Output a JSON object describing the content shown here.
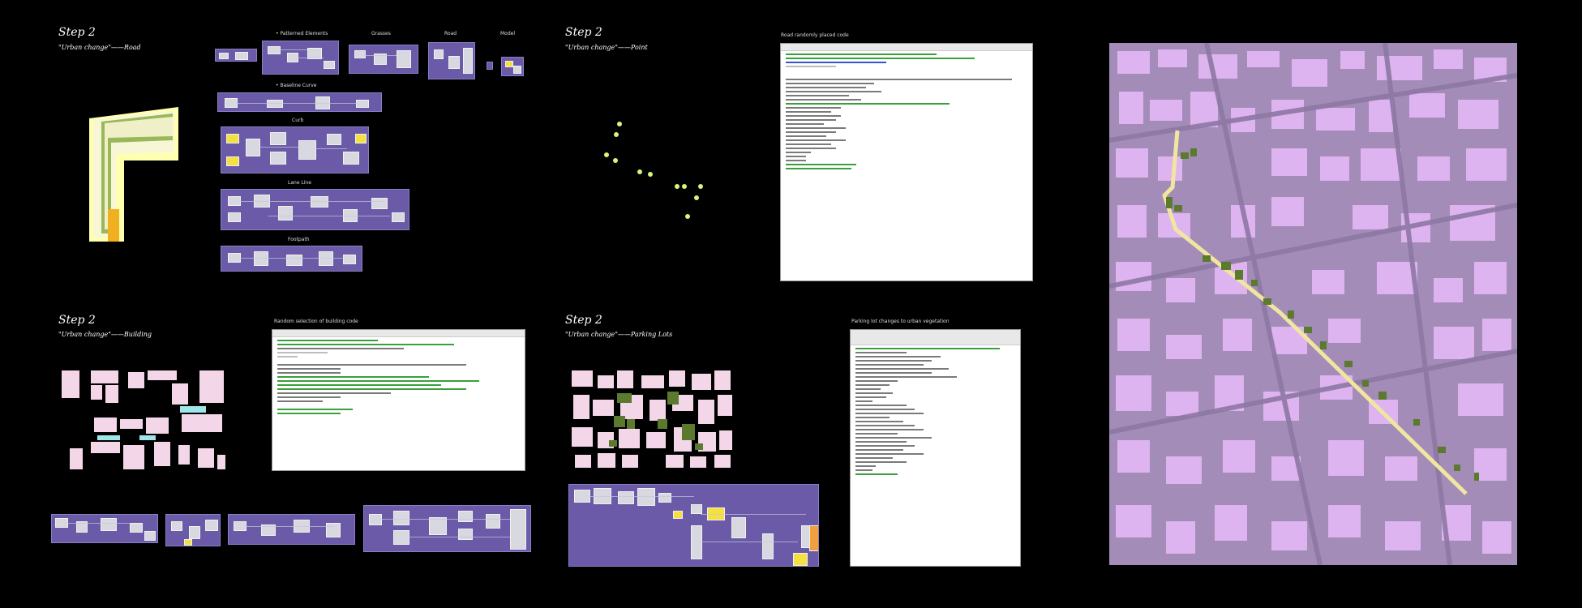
{
  "panels": {
    "road": {
      "step": "Step 2",
      "subtitle": "\"Urban change\"——Road",
      "captions": [
        "• Patterned Elements",
        "Grasses",
        "Road",
        "Model",
        "• Baseline Curve",
        "Curb",
        "Lane Line",
        "Footpath"
      ]
    },
    "point": {
      "step": "Step 2",
      "subtitle": "\"Urban change\"——Point",
      "code_caption": "Road randomly placed code"
    },
    "building": {
      "step": "Step 2",
      "subtitle": "\"Urban change\"——Building",
      "code_caption": "Random selection of building code"
    },
    "parking": {
      "step": "Step 2",
      "subtitle": "\"Urban change\"——Parking Lots",
      "code_caption": "Parking lot changes to urban vegetation"
    }
  },
  "colors": {
    "canvas": "#6a5aa8",
    "map_bg": "#a48cb8",
    "building": "#ddb3f0",
    "vegetation": "#5c7a2e",
    "road": "#f0e6a0",
    "point": "#d6f57a"
  }
}
